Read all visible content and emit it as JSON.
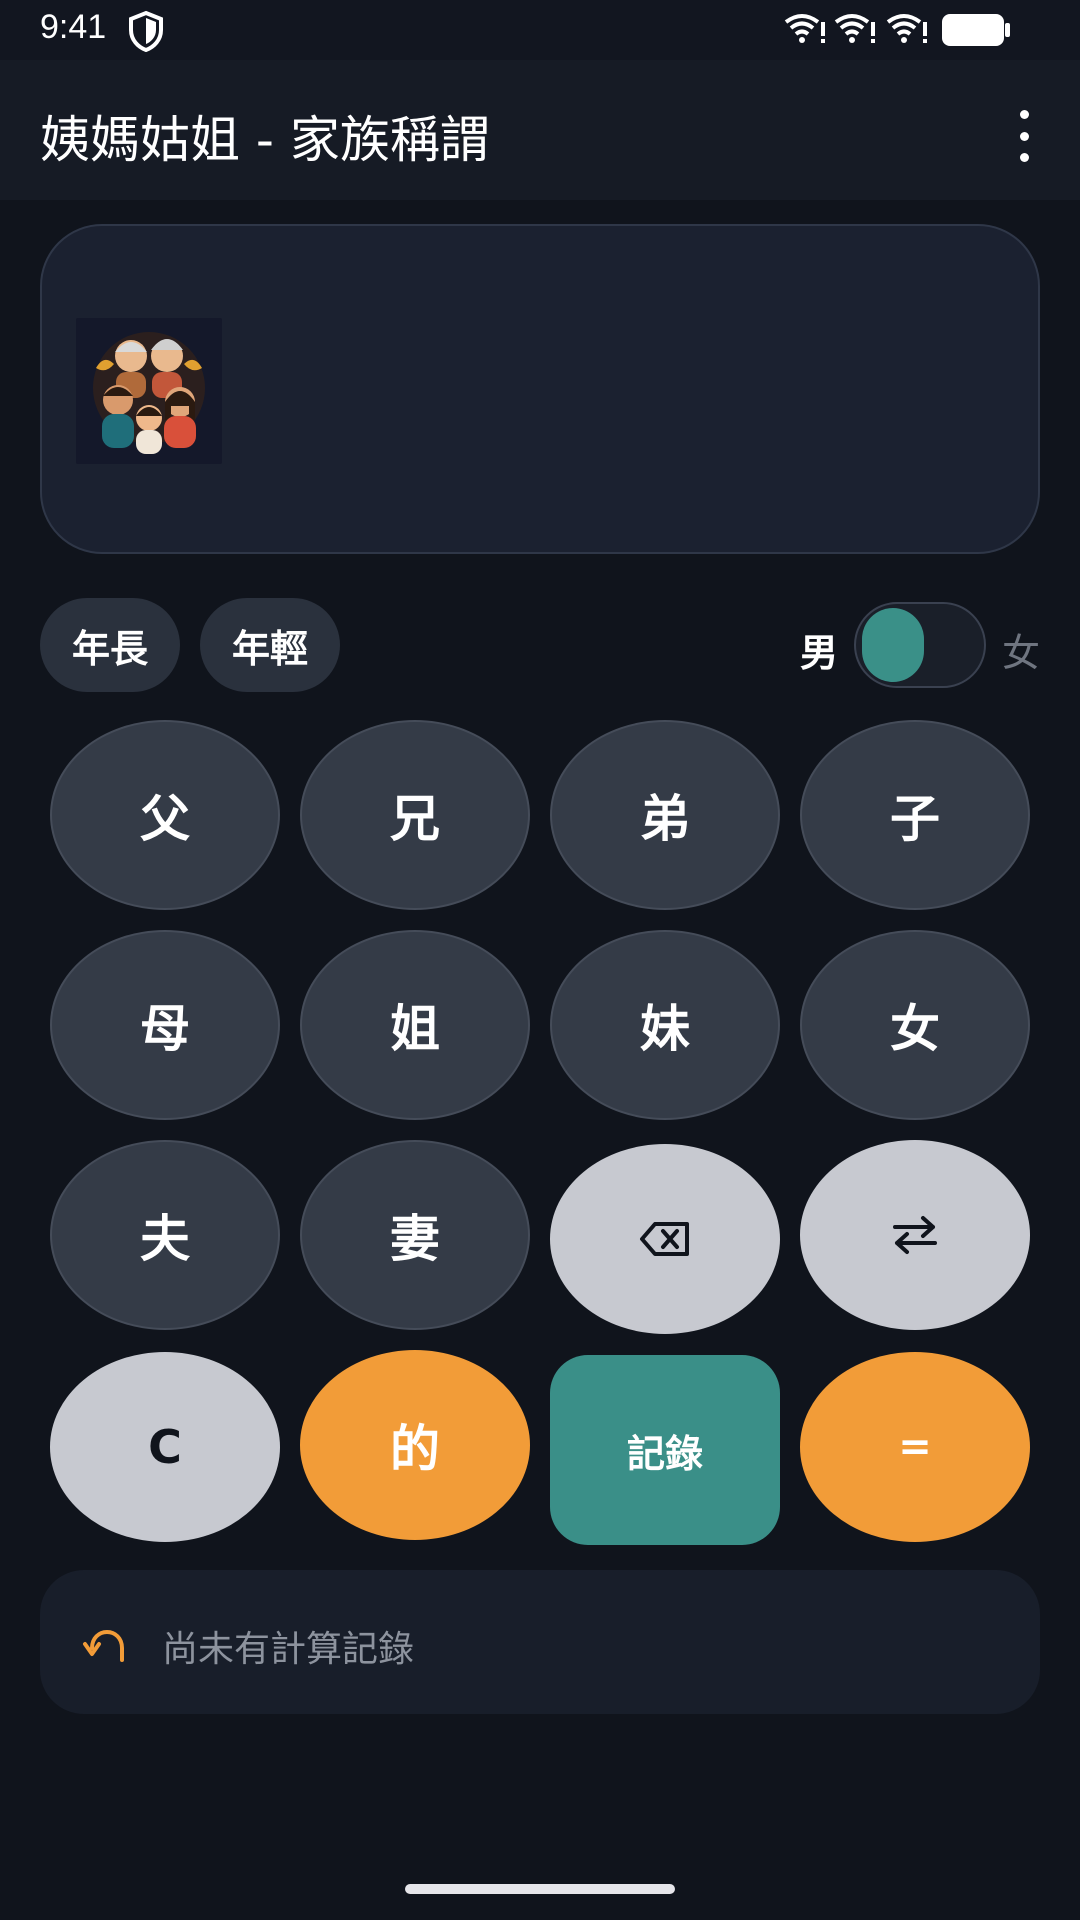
{
  "status_bar": {
    "time": "9:41",
    "icons": [
      "shield-icon",
      "wifi-alert-icon",
      "wifi-alert-icon",
      "wifi-alert-icon",
      "battery-icon"
    ]
  },
  "app_bar": {
    "title": "姨媽姑姐 - 家族稱謂",
    "menu_icon": "more-vertical-icon"
  },
  "display": {
    "image": "family-portrait-image",
    "result_text": ""
  },
  "modifiers": {
    "older_label": "年長",
    "younger_label": "年輕"
  },
  "gender": {
    "male_label": "男",
    "female_label": "女",
    "selected": "男"
  },
  "keypad": {
    "row1": [
      "父",
      "兄",
      "弟",
      "子"
    ],
    "row2": [
      "母",
      "姐",
      "妹",
      "女"
    ],
    "row3": [
      "夫",
      "妻"
    ],
    "backspace_icon": "backspace-icon",
    "swap_icon": "swap-arrows-icon",
    "clear_label": "C",
    "of_label": "的",
    "record_label": "記錄",
    "equals_label": "="
  },
  "history": {
    "icon": "undo-arrow-icon",
    "empty_text": "尚未有計算記錄"
  },
  "colors": {
    "accent_orange": "#f29c38",
    "accent_teal": "#3a8f88",
    "background": "#10141c"
  }
}
